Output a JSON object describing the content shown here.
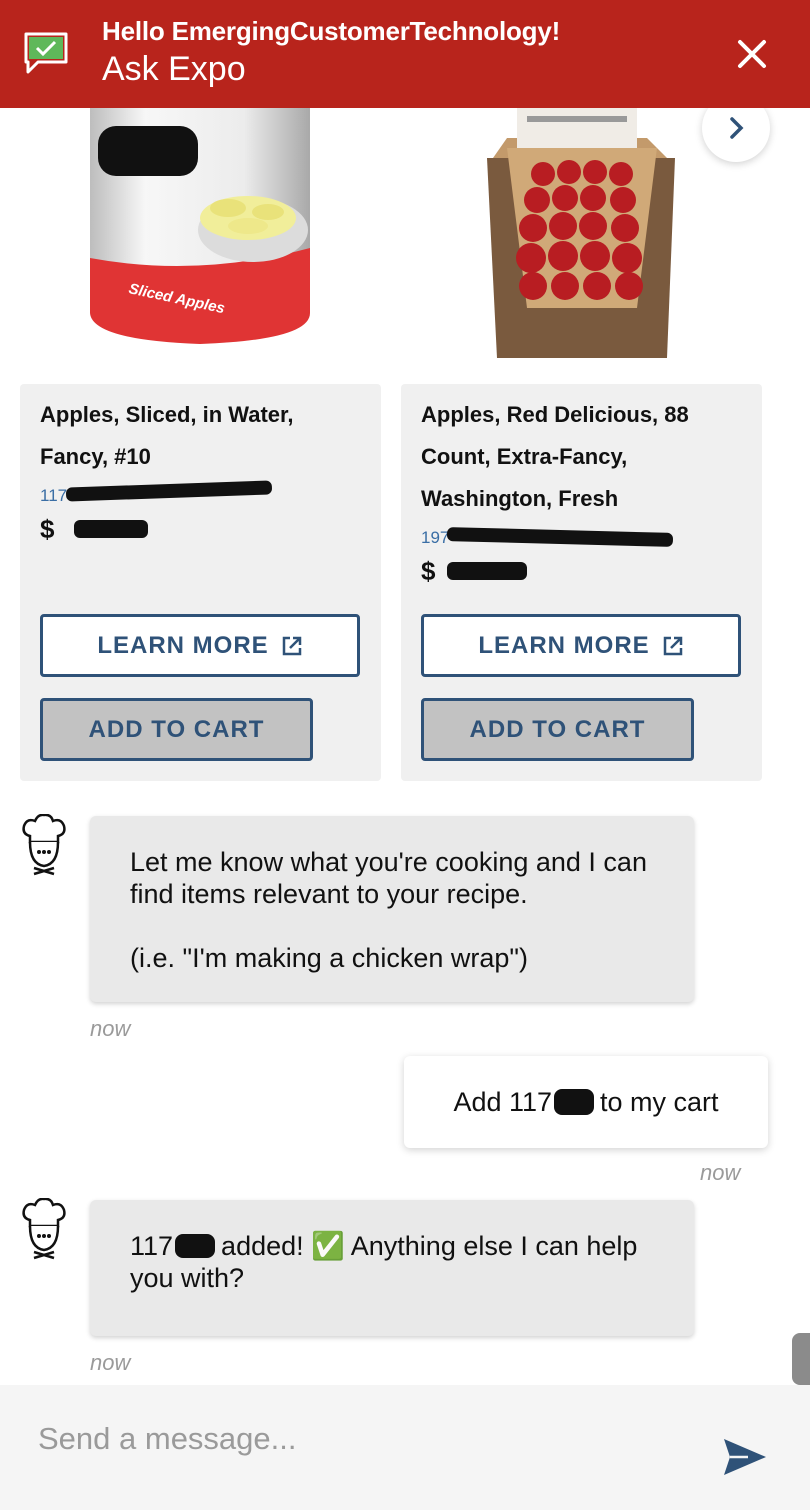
{
  "header": {
    "greeting": "Hello EmergingCustomerTechnology!",
    "title": "Ask Expo",
    "close_icon": "close-icon",
    "chat_icon": "chat-check-icon"
  },
  "colors": {
    "header_bg": "#b8241c",
    "accent": "#2f5278",
    "link": "#3a6ea5",
    "card_bg": "#f0f0f0",
    "bubble_bot_bg": "#e9e9e9"
  },
  "carousel": {
    "next_icon": "chevron-right-icon",
    "products": [
      {
        "name": "Apples, Sliced, in Water, Fancy, #10",
        "meta": "117",
        "price": "$",
        "learn_more": "LEARN MORE",
        "add_to_cart": "ADD TO CART"
      },
      {
        "name": "Apples, Red Delicious, 88 Count, Extra-Fancy, Washington, Fresh",
        "meta": "197",
        "price": "$",
        "learn_more": "LEARN MORE",
        "add_to_cart": "ADD TO CART"
      }
    ]
  },
  "can_label": "Sliced Apples",
  "chat": {
    "messages": [
      {
        "sender": "bot",
        "line1": "Let me know what you're cooking and I can find items relevant to your recipe.",
        "line2": "(i.e. \"I'm making a chicken wrap\")",
        "time": "now"
      },
      {
        "sender": "user",
        "pre": "Add 117",
        "post": "to my cart",
        "time": "now"
      },
      {
        "sender": "bot",
        "pre": "117",
        "post": "added! ✅ Anything else I can help you with?",
        "time": "now"
      }
    ]
  },
  "composer": {
    "placeholder": "Send a message...",
    "send_icon": "send-icon"
  }
}
